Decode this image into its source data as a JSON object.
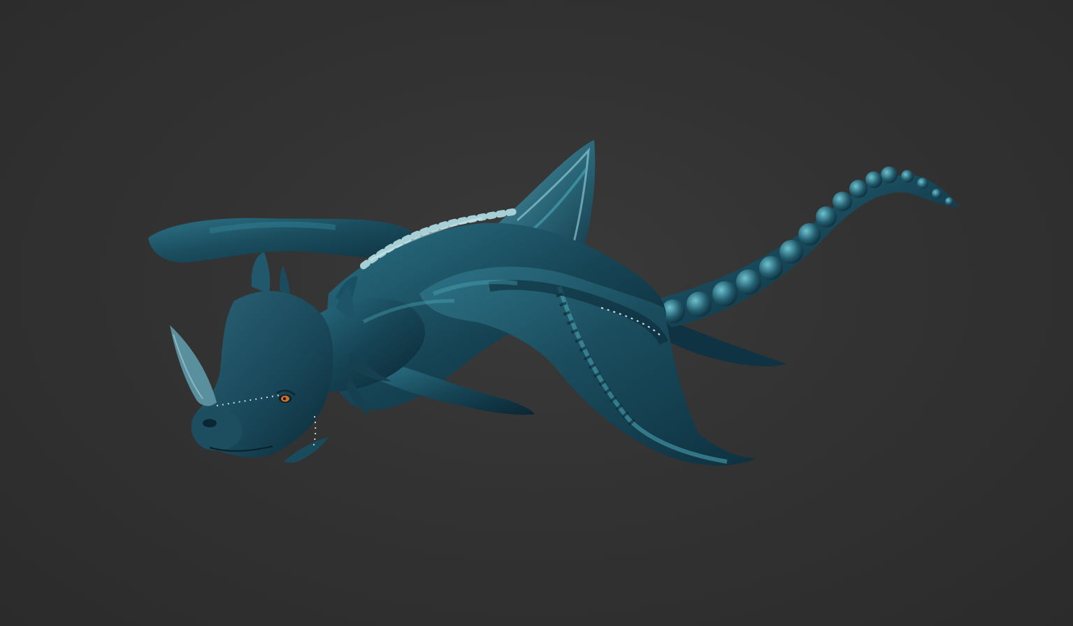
{
  "scene": {
    "subject": "dragon-sculpt-render",
    "background_color": "#313131",
    "colors": {
      "body_dark": "#0d2c3a",
      "body_mid": "#1d5a6e",
      "body_light": "#3f9fb2",
      "highlight": "#8fd6df",
      "eye": "#c8702e"
    }
  }
}
